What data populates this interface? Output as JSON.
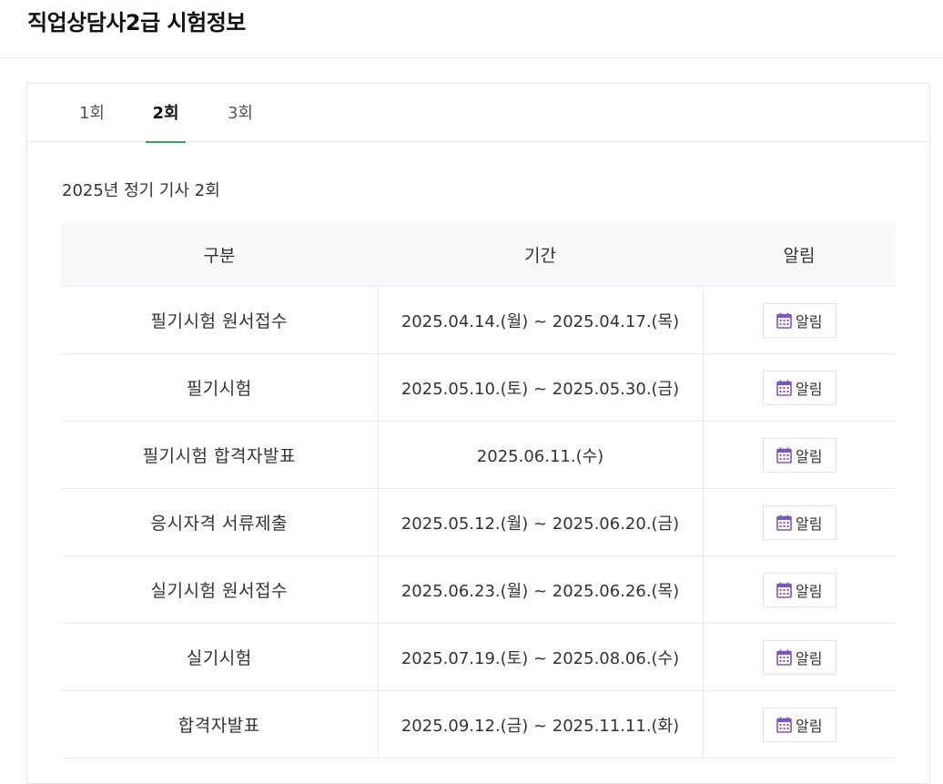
{
  "header": {
    "title": "직업상담사2급 시험정보"
  },
  "tabs": [
    {
      "label": "1회",
      "active": false
    },
    {
      "label": "2회",
      "active": true
    },
    {
      "label": "3회",
      "active": false
    }
  ],
  "colors": {
    "active_tab_underline": "#3aa655",
    "calendar_icon": "#7a56c9"
  },
  "session": {
    "title": "2025년 정기 기사 2회"
  },
  "table": {
    "headers": {
      "category": "구분",
      "period": "기간",
      "alert": "알림"
    },
    "rows": [
      {
        "category": "필기시험 원서접수",
        "period": "2025.04.14.(월) ~ 2025.04.17.(목)",
        "alert_label": "알림",
        "alert_icon": "calendar-icon"
      },
      {
        "category": "필기시험",
        "period": "2025.05.10.(토) ~ 2025.05.30.(금)",
        "alert_label": "알림",
        "alert_icon": "calendar-icon"
      },
      {
        "category": "필기시험 합격자발표",
        "period": "2025.06.11.(수)",
        "alert_label": "알림",
        "alert_icon": "calendar-icon"
      },
      {
        "category": "응시자격 서류제출",
        "period": "2025.05.12.(월) ~ 2025.06.20.(금)",
        "alert_label": "알림",
        "alert_icon": "calendar-icon"
      },
      {
        "category": "실기시험 원서접수",
        "period": "2025.06.23.(월) ~ 2025.06.26.(목)",
        "alert_label": "알림",
        "alert_icon": "calendar-icon"
      },
      {
        "category": "실기시험",
        "period": "2025.07.19.(토) ~ 2025.08.06.(수)",
        "alert_label": "알림",
        "alert_icon": "calendar-icon"
      },
      {
        "category": "합격자발표",
        "period": "2025.09.12.(금) ~ 2025.11.11.(화)",
        "alert_label": "알림",
        "alert_icon": "calendar-icon"
      }
    ]
  }
}
